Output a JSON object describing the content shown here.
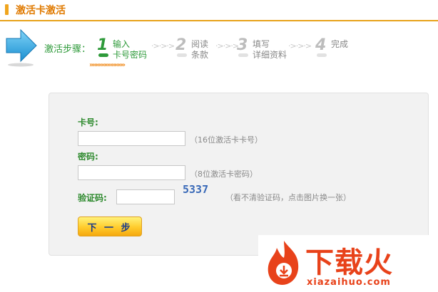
{
  "header": {
    "title": "激活卡激活"
  },
  "steps": {
    "label": "激活步骤：",
    "items": [
      {
        "num": "1",
        "line1": "输入",
        "line2": "卡号密码",
        "active": true
      },
      {
        "num": "2",
        "line1": "阅读",
        "line2": "条款",
        "active": false
      },
      {
        "num": "3",
        "line1": "填写",
        "line2": "详细资料",
        "active": false
      },
      {
        "num": "4",
        "line1": "完成",
        "line2": "",
        "active": false
      }
    ],
    "separator": "·>·>·>"
  },
  "form": {
    "card_number": {
      "label": "卡号:",
      "value": "",
      "hint": "（16位激活卡卡号）"
    },
    "password": {
      "label": "密码:",
      "value": "",
      "hint": "（8位激活卡密码）"
    },
    "captcha": {
      "label": "验证码:",
      "value": "",
      "image_text": "5337",
      "hint": "（看不清验证码，点击图片换一张）"
    },
    "next_button": "下 一 步"
  },
  "watermark": {
    "cn": "下载火",
    "en": "xiazaihuo.com"
  },
  "colors": {
    "accent_orange": "#e8a21a",
    "step_green": "#2e9a3a",
    "watermark_red": "#e8421a"
  }
}
